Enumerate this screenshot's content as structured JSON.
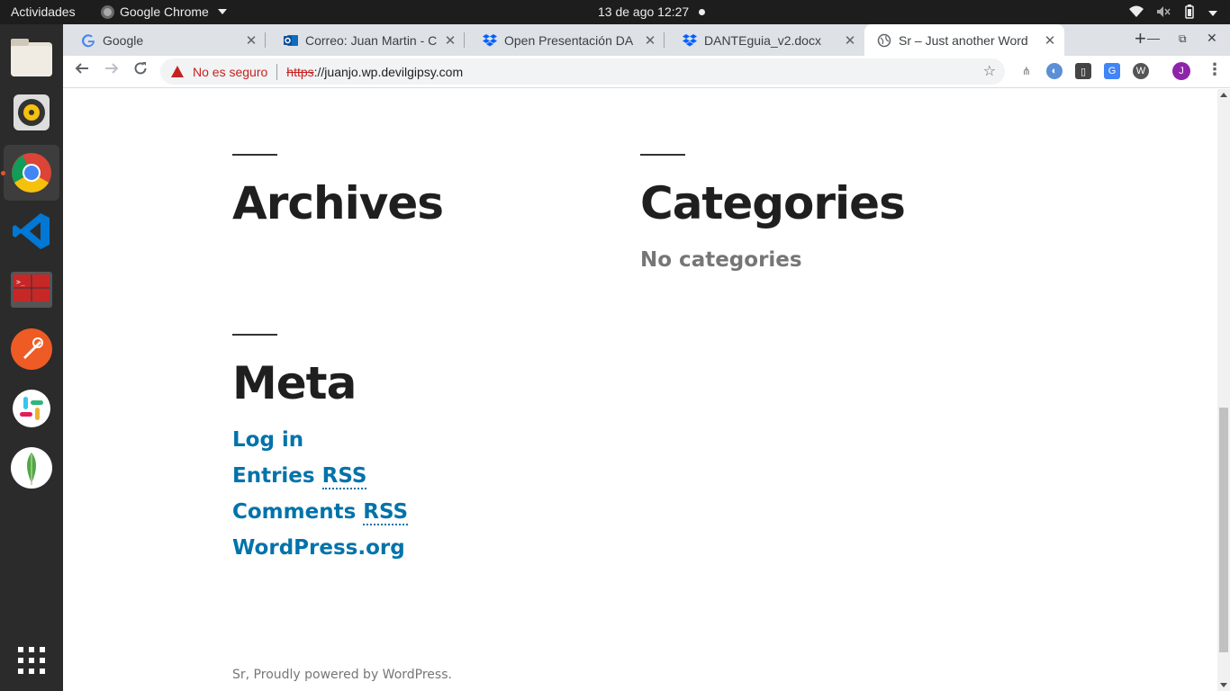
{
  "topbar": {
    "activities": "Actividades",
    "app_name": "Google Chrome",
    "clock": "13 de ago  12:27"
  },
  "dock": {
    "items": [
      "files-icon",
      "rhythmbox-icon",
      "chrome-icon",
      "vscode-icon",
      "terminal-icon",
      "postman-icon",
      "slack-icon",
      "mongodb-icon",
      "apps-grid-icon"
    ]
  },
  "tabs": [
    {
      "title": "Google",
      "favicon": "google-icon"
    },
    {
      "title": "Correo: Juan Martin - C",
      "favicon": "outlook-icon"
    },
    {
      "title": "Open Presentación DA",
      "favicon": "dropbox-icon"
    },
    {
      "title": "DANTEguia_v2.docx",
      "favicon": "dropbox-icon"
    },
    {
      "title": "Sr – Just another Word",
      "favicon": "globe-icon"
    }
  ],
  "toolbar": {
    "not_secure": "No es seguro",
    "url_scheme": "https",
    "url_rest": "://juanjo.wp.devilgipsy.com",
    "avatar_initial": "J"
  },
  "page": {
    "archives_title": "Archives",
    "categories_title": "Categories",
    "no_categories": "No categories",
    "meta_title": "Meta",
    "meta_links": {
      "login": "Log in",
      "entries_prefix": "Entries ",
      "entries_rss": "RSS",
      "comments_prefix": "Comments ",
      "comments_rss": "RSS",
      "wordpress": "WordPress.org"
    },
    "footer": "Sr, Proudly powered by WordPress."
  },
  "colors": {
    "link": "#0073aa",
    "text_muted": "#767676",
    "heading": "#1f1f1f",
    "insecure": "#c5221f"
  }
}
